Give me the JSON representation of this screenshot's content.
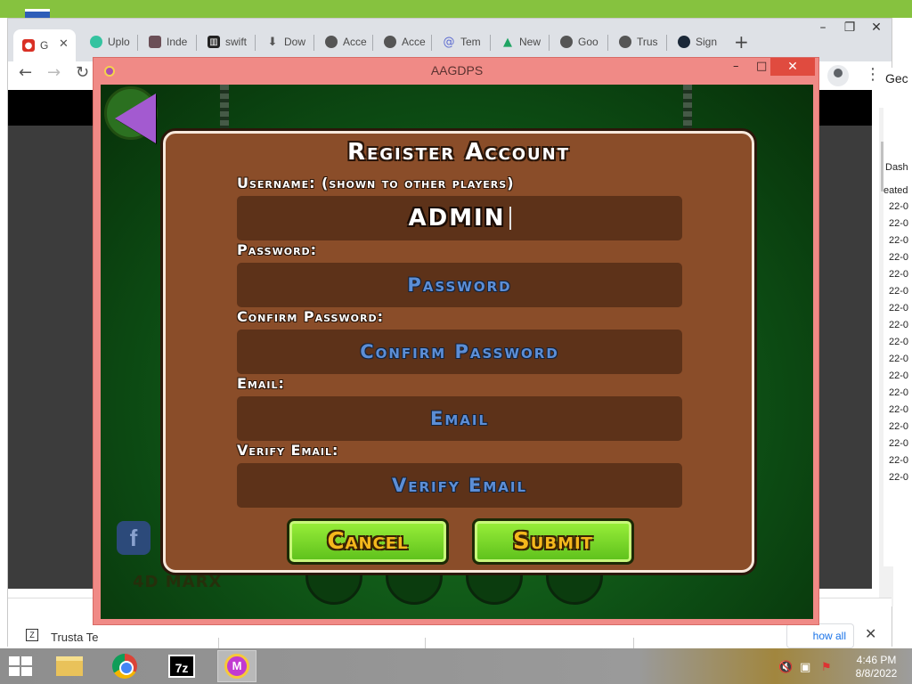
{
  "browser": {
    "tabs": [
      {
        "label": "G",
        "icon": "lock-icon",
        "color": "#d93025"
      },
      {
        "label": "Uplo",
        "icon": "upload-icon",
        "color": "#34c3a0"
      },
      {
        "label": "Inde",
        "icon": "image-icon",
        "color": "#6b4f57"
      },
      {
        "label": "swift",
        "icon": "archive-icon",
        "color": "#222222"
      },
      {
        "label": "Dow",
        "icon": "download-icon",
        "color": "#555555"
      },
      {
        "label": "Acce",
        "icon": "globe-icon",
        "color": "#555555"
      },
      {
        "label": "Acce",
        "icon": "globe-icon",
        "color": "#555555"
      },
      {
        "label": "Tem",
        "icon": "at-icon",
        "color": "#5b6ad0"
      },
      {
        "label": "New",
        "icon": "drive-icon",
        "color": "#1fa463"
      },
      {
        "label": "Goo",
        "icon": "globe-icon",
        "color": "#555555"
      },
      {
        "label": "Trus",
        "icon": "globe-icon",
        "color": "#555555"
      },
      {
        "label": "Sign",
        "icon": "steam-icon",
        "color": "#1b2838"
      }
    ],
    "new_tab": "+",
    "right_panel": {
      "header": "Gec",
      "tab": "Dash",
      "subheader": "eated",
      "rows": [
        "22-0",
        "22-0",
        "22-0",
        "22-0",
        "22-0",
        "22-0",
        "22-0",
        "22-0",
        "22-0",
        "22-0",
        "22-0",
        "22-0",
        "22-0",
        "22-0",
        "22-0",
        "22-0",
        "22-0"
      ]
    },
    "download_bar": {
      "file_label": "Trusta Te",
      "show_all": "how all",
      "close": "✕"
    }
  },
  "game_window": {
    "title": "AAGDPS",
    "background_label": "4D MARX",
    "dialog": {
      "title": "Register Account",
      "fields": [
        {
          "label": "Username: (shown to other players)",
          "value": "ADMIN",
          "placeholder": ""
        },
        {
          "label": "Password:",
          "value": "",
          "placeholder": "Password"
        },
        {
          "label": "Confirm Password:",
          "value": "",
          "placeholder": "Confirm Password"
        },
        {
          "label": "Email:",
          "value": "",
          "placeholder": "Email"
        },
        {
          "label": "Verify Email:",
          "value": "",
          "placeholder": "Verify Email"
        }
      ],
      "cancel_label": "Cancel",
      "submit_label": "Submit"
    }
  },
  "taskbar": {
    "apps": [
      "file-explorer-icon",
      "chrome-icon",
      "7zip-icon",
      "geometry-dash-icon"
    ],
    "sevenzip_text": "7z",
    "gd_text": "M",
    "clock_time": "4:46 PM",
    "clock_date": "8/8/2022"
  },
  "colors": {
    "dialog_bg": "#8a4d29",
    "field_bg": "#5d3219",
    "placeholder": "#5c8ed6",
    "button_green": "#7fdd2c",
    "window_frame": "#f08a86"
  }
}
